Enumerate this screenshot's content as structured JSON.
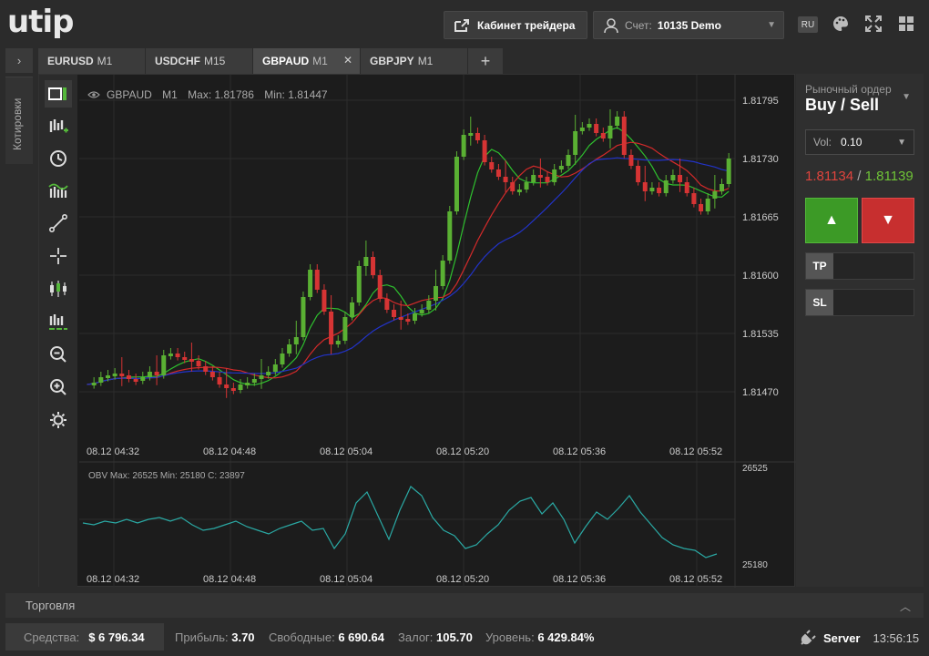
{
  "header": {
    "logo": "utip",
    "cabinet_label": "Кабинет трейдера",
    "account_label": "Счет:",
    "account_value": "10135 Demo",
    "lang": "RU"
  },
  "sidebar": {
    "quotes_label": "Котировки"
  },
  "tabs": [
    {
      "symbol": "EURUSD",
      "tf": "M1"
    },
    {
      "symbol": "USDCHF",
      "tf": "M15"
    },
    {
      "symbol": "GBPAUD",
      "tf": "M1",
      "active": true
    },
    {
      "symbol": "GBPJPY",
      "tf": "M1"
    }
  ],
  "chart": {
    "legend_symbol": "GBPAUD",
    "legend_tf": "M1",
    "legend_max": "Max: 1.81786",
    "legend_min": "Min: 1.81447",
    "price_ticks": [
      "1.81795",
      "1.81730",
      "1.81665",
      "1.81600",
      "1.81535",
      "1.81470"
    ],
    "time_ticks": [
      "08.12 04:32",
      "08.12 04:48",
      "08.12 05:04",
      "08.12 05:20",
      "08.12 05:36",
      "08.12 05:52"
    ],
    "obv_legend": "OBV  Max: 26525  Min: 25180  C: 23897",
    "obv_ticks": [
      "26525",
      "25180"
    ]
  },
  "chart_data": {
    "type": "candlestick",
    "price_range": [
      1.8142,
      1.8182
    ],
    "candles_note_omitted": "",
    "obv": {
      "max": 26525,
      "min": 25180,
      "current": 23897
    }
  },
  "order": {
    "header": "Рыночный ордер",
    "title": "Buy / Sell",
    "vol_label": "Vol:",
    "vol_value": "0.10",
    "bid": "1.81134",
    "ask": "1.81139",
    "tp": "TP",
    "sl": "SL"
  },
  "trading": {
    "label": "Торговля"
  },
  "status": {
    "funds_label": "Средства:",
    "funds_value": "$ 6 796.34",
    "profit_label": "Прибыль:",
    "profit_value": "3.70",
    "free_label": "Свободные:",
    "free_value": "6 690.64",
    "margin_label": "Залог:",
    "margin_value": "105.70",
    "level_label": "Уровень:",
    "level_value": "6 429.84%",
    "server_label": "Server",
    "time": "13:56:15"
  }
}
